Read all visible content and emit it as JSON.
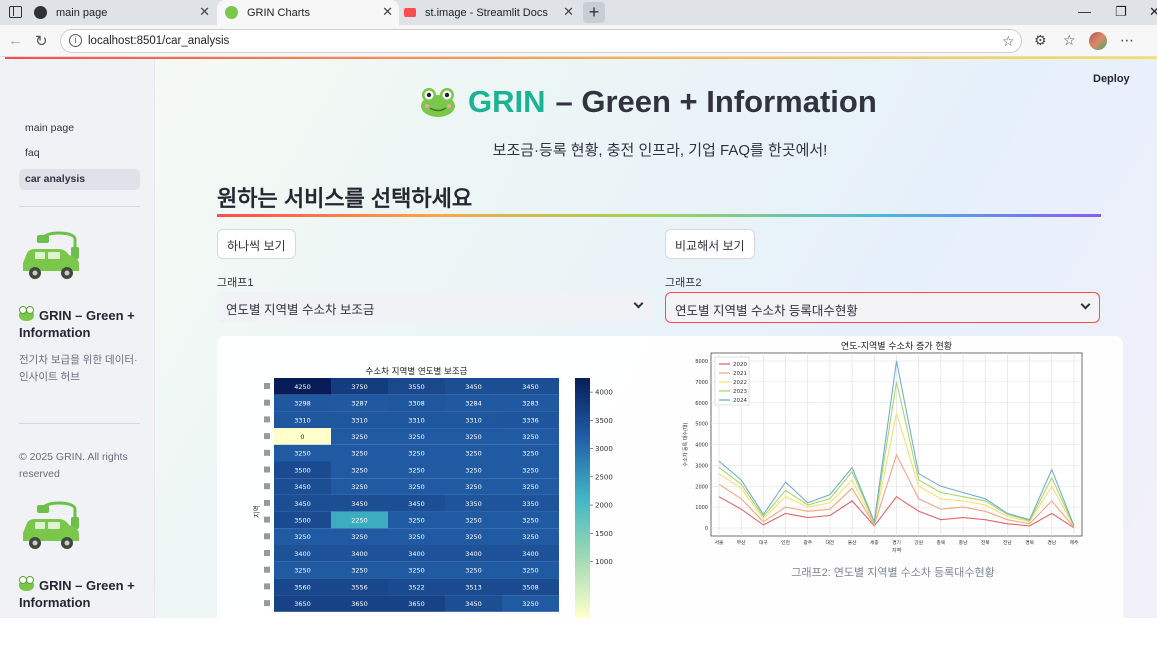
{
  "browser": {
    "tabs": [
      {
        "title": "main page",
        "active": false,
        "favicon_color": "#2f3136"
      },
      {
        "title": "GRIN Charts",
        "active": true,
        "favicon_color": "#7bc74c"
      },
      {
        "title": "st.image - Streamlit Docs",
        "active": false,
        "favicon_color": "#ff4b4b"
      }
    ],
    "url": "localhost:8501/car_analysis"
  },
  "app": {
    "deploy_label": "Deploy",
    "sidebar": {
      "nav": [
        {
          "label": "main page",
          "active": false
        },
        {
          "label": "faq",
          "active": false
        },
        {
          "label": "car analysis",
          "active": true
        }
      ],
      "brand_title": "GRIN – Green + Information",
      "brand_desc": "전기차 보급을 위한 데이터·인사이트 허브",
      "footer": "© 2025 GRIN. All rights reserved",
      "brand_title_2": "GRIN – Green + Information"
    },
    "header": {
      "title_brand": "GRIN",
      "title_rest": "– Green + Information",
      "subtitle": "보조금·등록 현황, 충전 인프라, 기업 FAQ를 한곳에서!"
    },
    "section_title": "원하는 서비스를 선택하세요",
    "buttons": {
      "single": "하나씩 보기",
      "compare": "비교해서 보기"
    },
    "graph1": {
      "label": "그래프1",
      "value": "연도별 지역별 수소차 보조금"
    },
    "graph2": {
      "label": "그래프2",
      "value": "연도별 지역별 수소차 등록대수현황"
    },
    "caption2": "그래프2: 연도별 지역별 수소차 등록대수현황"
  },
  "chart_data": [
    {
      "type": "heatmap",
      "title": "수소차 지역별 연도별 보조금",
      "ylabel": "지역",
      "colorbar_ticks": [
        1000,
        1500,
        2000,
        2500,
        3000,
        3500,
        4000
      ],
      "vmin": 0,
      "vmax": 4250,
      "rows": [
        [
          4250,
          3750,
          3550,
          3450,
          3450
        ],
        [
          3298,
          3287,
          3308,
          3284,
          3283
        ],
        [
          3310,
          3310,
          3310,
          3310,
          3336
        ],
        [
          0,
          3250,
          3250,
          3250,
          3250
        ],
        [
          3250,
          3250,
          3250,
          3250,
          3250
        ],
        [
          3500,
          3250,
          3250,
          3250,
          3250
        ],
        [
          3450,
          3250,
          3250,
          3250,
          3250
        ],
        [
          3450,
          3450,
          3450,
          3350,
          3350
        ],
        [
          3500,
          2250,
          3250,
          3250,
          3250
        ],
        [
          3250,
          3250,
          3250,
          3250,
          3250
        ],
        [
          3400,
          3400,
          3400,
          3400,
          3400
        ],
        [
          3250,
          3250,
          3250,
          3250,
          3250
        ],
        [
          3560,
          3556,
          3522,
          3513,
          3508
        ],
        [
          3650,
          3650,
          3650,
          3450,
          3250
        ]
      ]
    },
    {
      "type": "line",
      "title": "연도-지역별 수소차 증가 현황",
      "xlabel": "지역",
      "ylabel": "수소차 등록 대수(대)",
      "x": [
        "서울",
        "부산",
        "대구",
        "인천",
        "광주",
        "대전",
        "울산",
        "세종",
        "경기",
        "강원",
        "충북",
        "충남",
        "전북",
        "전남",
        "경북",
        "경남",
        "제주"
      ],
      "ylim": [
        0,
        8000
      ],
      "yticks": [
        0,
        1000,
        2000,
        3000,
        4000,
        5000,
        6000,
        7000,
        8000
      ],
      "grid": true,
      "legend": "top-left",
      "series": [
        {
          "name": "2020",
          "color": "#e06666",
          "values": [
            1500,
            900,
            150,
            700,
            500,
            600,
            1300,
            100,
            1500,
            800,
            400,
            500,
            400,
            200,
            100,
            700,
            10
          ]
        },
        {
          "name": "2021",
          "color": "#f4a582",
          "values": [
            2100,
            1400,
            300,
            1000,
            800,
            900,
            1900,
            150,
            3500,
            1400,
            900,
            1000,
            800,
            400,
            200,
            1300,
            30
          ]
        },
        {
          "name": "2022",
          "color": "#f6e06e",
          "values": [
            2600,
            1900,
            450,
            1500,
            1000,
            1200,
            2300,
            200,
            5500,
            2000,
            1400,
            1300,
            1100,
            550,
            300,
            2000,
            60
          ]
        },
        {
          "name": "2023",
          "color": "#a6d96a",
          "values": [
            2900,
            2100,
            550,
            1800,
            1100,
            1400,
            2700,
            250,
            7000,
            2300,
            1700,
            1500,
            1300,
            650,
            350,
            2400,
            80
          ]
        },
        {
          "name": "2024",
          "color": "#74add1",
          "values": [
            3200,
            2300,
            650,
            2200,
            1200,
            1600,
            2900,
            300,
            8000,
            2600,
            2000,
            1700,
            1400,
            700,
            400,
            2800,
            100
          ]
        }
      ]
    }
  ]
}
